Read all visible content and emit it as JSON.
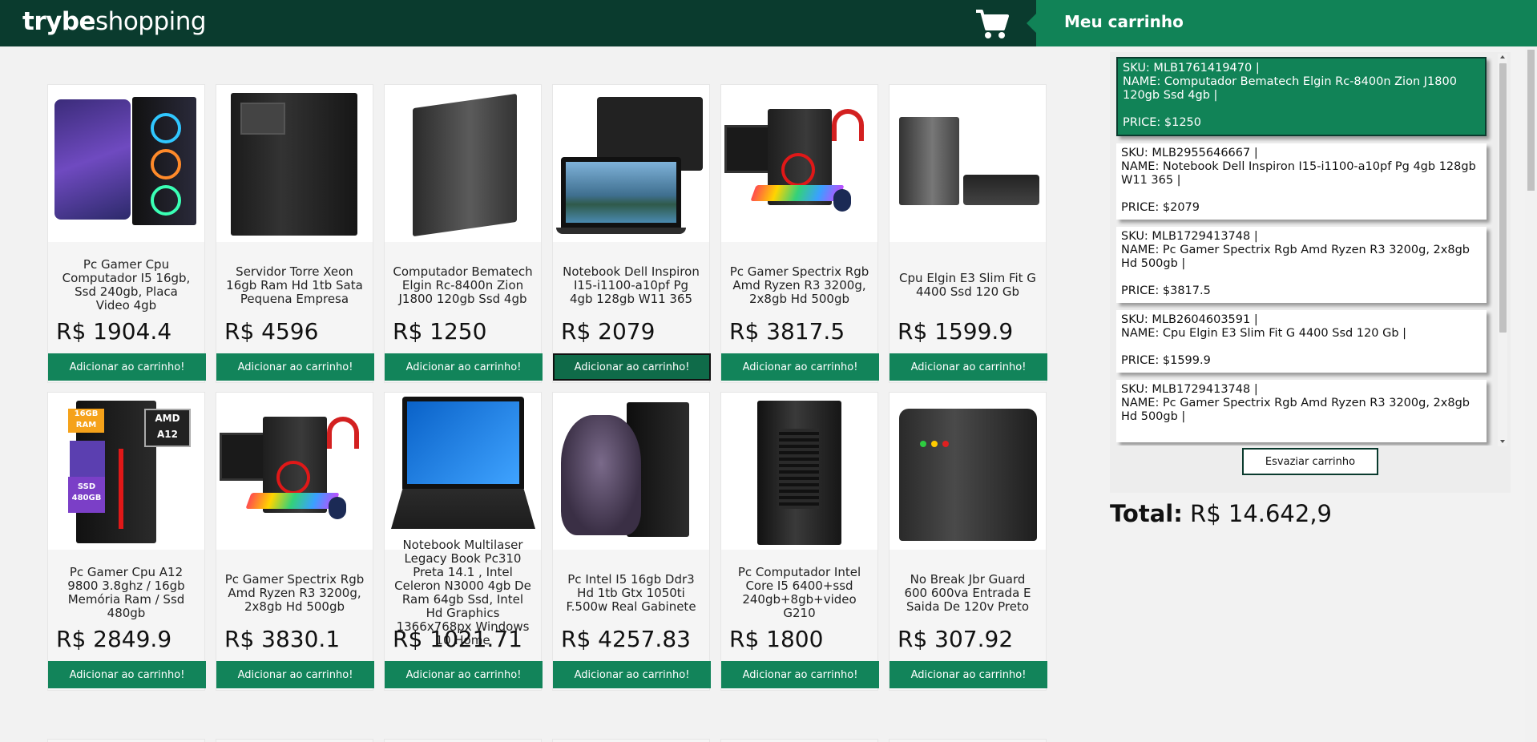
{
  "header": {
    "logo_bold": "trybe",
    "logo_light": "shopping",
    "cart_title": "Meu carrinho"
  },
  "products": [
    {
      "name": "Pc Gamer Cpu Computador I5 16gb, Ssd 240gb, Placa Video 4gb",
      "price": "R$ 1904.4",
      "button": "Adicionar ao carrinho!"
    },
    {
      "name": "Servidor Torre Xeon 16gb Ram Hd 1tb Sata Pequena Empresa",
      "price": "R$ 4596",
      "button": "Adicionar ao carrinho!"
    },
    {
      "name": "Computador Bematech Elgin Rc-8400n Zion J1800 120gb Ssd 4gb",
      "price": "R$ 1250",
      "button": "Adicionar ao carrinho!"
    },
    {
      "name": "Notebook Dell Inspiron I15-i1100-a10pf Pg 4gb 128gb W11 365",
      "price": "R$ 2079",
      "button": "Adicionar ao carrinho!"
    },
    {
      "name": "Pc Gamer Spectrix Rgb Amd Ryzen R3 3200g, 2x8gb Hd 500gb",
      "price": "R$ 3817.5",
      "button": "Adicionar ao carrinho!"
    },
    {
      "name": "Cpu Elgin E3 Slim Fit G 4400 Ssd 120 Gb",
      "price": "R$ 1599.9",
      "button": "Adicionar ao carrinho!"
    },
    {
      "name": "Pc Gamer Cpu A12 9800 3.8ghz / 16gb Memória Ram / Ssd 480gb",
      "price": "R$ 2849.9",
      "button": "Adicionar ao carrinho!",
      "thumb_labels": {
        "ram": "16GB RAM",
        "ssd": "SSD 480GB",
        "cpu": "AMD A12"
      }
    },
    {
      "name": "Pc Gamer Spectrix Rgb Amd Ryzen R3 3200g, 2x8gb Hd 500gb",
      "price": "R$ 3830.1",
      "button": "Adicionar ao carrinho!"
    },
    {
      "name": "Notebook Multilaser Legacy Book Pc310 Preta 14.1 , Intel Celeron N3000 4gb De Ram 64gb Ssd, Intel Hd Graphics 1366x768px Windows 10 Home",
      "price": "R$ 1021.71",
      "button": "Adicionar ao carrinho!"
    },
    {
      "name": "Pc Intel I5 16gb Ddr3 Hd 1tb Gtx 1050ti F.500w Real Gabinete",
      "price": "R$ 4257.83",
      "button": "Adicionar ao carrinho!"
    },
    {
      "name": "Pc Computador Intel Core I5 6400+ssd 240gb+8gb+video G210",
      "price": "R$ 1800",
      "button": "Adicionar ao carrinho!"
    },
    {
      "name": "No Break Jbr Guard 600 600va Entrada E Saida De 120v Preto",
      "price": "R$ 307.92",
      "button": "Adicionar ao carrinho!"
    }
  ],
  "cart": {
    "items": [
      {
        "sku": "SKU: MLB1761419470 |",
        "name": "NAME: Computador Bematech Elgin Rc-8400n Zion J1800 120gb Ssd 4gb |",
        "price": "PRICE: $1250"
      },
      {
        "sku": "SKU: MLB2955646667 |",
        "name": "NAME: Notebook Dell Inspiron I15-i1100-a10pf Pg 4gb 128gb W11 365 |",
        "price": "PRICE: $2079"
      },
      {
        "sku": "SKU: MLB1729413748 |",
        "name": "NAME: Pc Gamer Spectrix Rgb Amd Ryzen R3 3200g, 2x8gb Hd 500gb |",
        "price": "PRICE: $3817.5"
      },
      {
        "sku": "SKU: MLB2604603591 |",
        "name": "NAME: Cpu Elgin E3 Slim Fit G 4400 Ssd 120 Gb |",
        "price": "PRICE: $1599.9"
      },
      {
        "sku": "SKU: MLB1729413748 |",
        "name": "NAME: Pc Gamer Spectrix Rgb Amd Ryzen R3 3200g, 2x8gb Hd 500gb |",
        "price": ""
      }
    ],
    "empty_button": "Esvaziar carrinho",
    "total_label": "Total:",
    "total_value": "R$ 14.642,9"
  },
  "colors": {
    "header_bg": "#0a3b2e",
    "accent_green": "#118357",
    "button_green": "#12845a"
  },
  "icons": {
    "cart": "shopping-cart-icon"
  }
}
